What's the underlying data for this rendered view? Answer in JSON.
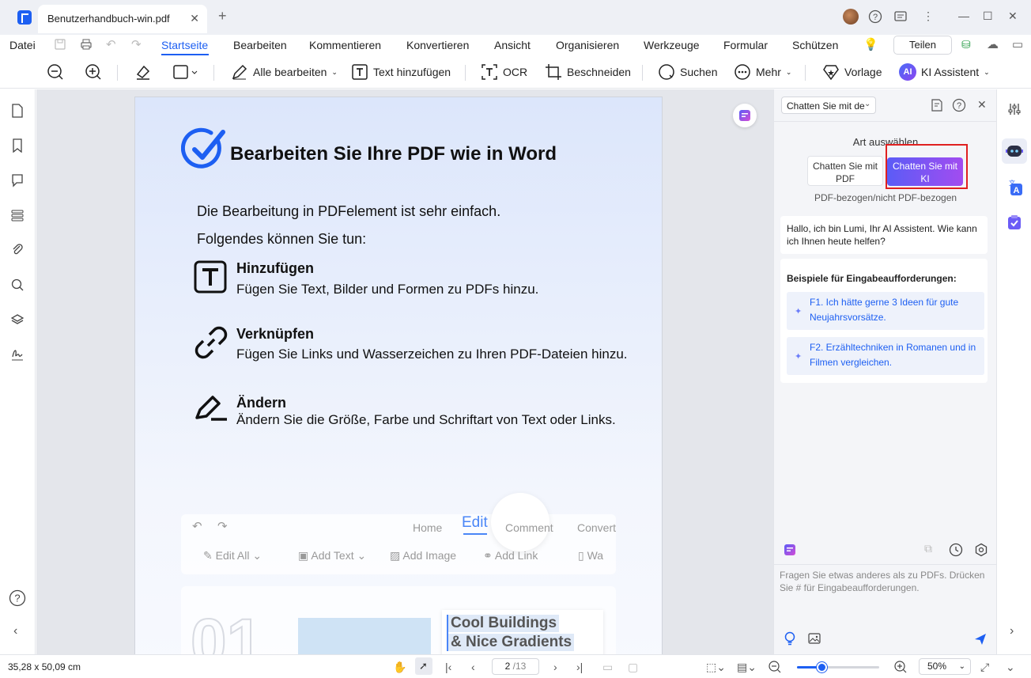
{
  "tab": {
    "title": "Benutzerhandbuch-win.pdf"
  },
  "menu": {
    "file": "Datei",
    "items": [
      "Startseite",
      "Bearbeiten",
      "Kommentieren",
      "Konvertieren",
      "Ansicht",
      "Organisieren",
      "Werkzeuge",
      "Formular",
      "Schützen"
    ],
    "share": "Teilen"
  },
  "toolbar": {
    "edit_all": "Alle bearbeiten",
    "add_text": "Text hinzufügen",
    "ocr": "OCR",
    "crop": "Beschneiden",
    "search": "Suchen",
    "more": "Mehr",
    "template": "Vorlage",
    "ai": "KI Assistent",
    "ai_badge": "AI"
  },
  "document": {
    "title": "Bearbeiten Sie Ihre PDF wie in Word",
    "intro1": "Die Bearbeitung in PDFelement ist sehr einfach.",
    "intro2": "Folgendes können Sie tun:",
    "sections": [
      {
        "heading": "Hinzufügen",
        "text": "Fügen Sie Text, Bilder und Formen zu PDFs hinzu."
      },
      {
        "heading": "Verknüpfen",
        "text": "Fügen Sie Links und Wasserzeichen zu Ihren PDF-Dateien hinzu."
      },
      {
        "heading": "Ändern",
        "text": "Ändern Sie die Größe, Farbe und Schriftart von Text oder Links."
      }
    ],
    "mock": {
      "home": "Home",
      "edit": "Edit",
      "comment": "Comment",
      "convert": "Convert",
      "edit_all": "Edit All",
      "add_text": "Add Text",
      "add_image": "Add Image",
      "add_link": "Add Link",
      "wa": "Wa",
      "card_line1": "Cool Buildings",
      "card_line2": "& Nice Gradients",
      "big_number": "01"
    }
  },
  "ai_panel": {
    "mode_select": "Chatten Sie mit de",
    "choose_type": "Art auswählen",
    "type_pdf": "Chatten Sie mit PDF",
    "type_ki": "Chatten Sie mit KI",
    "type_sub": "PDF-bezogen/nicht PDF-bezogen",
    "greeting": "Hallo, ich bin Lumi, Ihr AI Assistent. Wie kann ich Ihnen heute helfen?",
    "examples_title": "Beispiele für Eingabeaufforderungen:",
    "examples": [
      "F1. Ich hätte gerne 3 Ideen für gute Neujahrsvorsätze.",
      "F2. Erzähltechniken in Romanen und in Filmen vergleichen."
    ],
    "input_placeholder": "Fragen Sie etwas anderes als zu PDFs. Drücken Sie # für Eingabeaufforderungen."
  },
  "status": {
    "dimensions": "35,28 x 50,09 cm",
    "page_current": "2",
    "page_total": "/13",
    "zoom": "50%",
    "zoom_level": 0.3
  },
  "colors": {
    "accent": "#1d5ff2",
    "highlight": "#e02020",
    "ki_gradient_start": "#5b5cf6",
    "ki_gradient_end": "#a24cf0"
  }
}
